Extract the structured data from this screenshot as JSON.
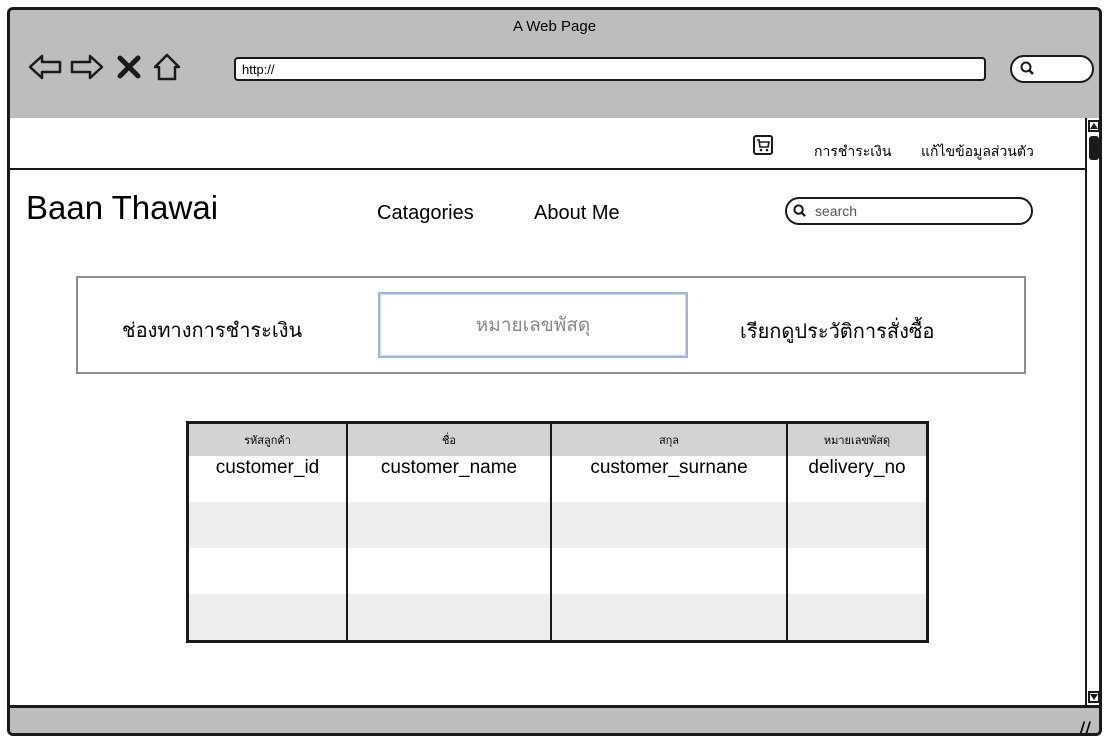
{
  "window": {
    "title": "A Web Page"
  },
  "browser": {
    "url": "http://",
    "nav": {
      "back_icon": "arrow-left-icon",
      "forward_icon": "arrow-right-icon",
      "stop_icon": "close-icon",
      "home_icon": "home-icon"
    }
  },
  "topbar": {
    "cart_icon": "cart-icon",
    "links": [
      "การชำระเงิน",
      "แก้ไขข้อมูลส่วนตัว"
    ]
  },
  "site": {
    "brand": "Baan Thawai",
    "nav": [
      "Catagories",
      "About Me"
    ],
    "search_placeholder": "search"
  },
  "panel": {
    "left_label": "ช่องทางการชำระเงิน",
    "input_placeholder": "หมายเลขพัสดุ",
    "right_label": "เรียกดูประวัติการสั่งซื้อ"
  },
  "table": {
    "headers": [
      "รหัสลูกค้า",
      "ชื่อ",
      "สกุล",
      "หมายเลขพัสดุ"
    ],
    "rows": [
      [
        "customer_id",
        "customer_name",
        "customer_surnane",
        "delivery_no"
      ],
      [
        "",
        "",
        "",
        ""
      ],
      [
        "",
        "",
        "",
        ""
      ],
      [
        "",
        "",
        "",
        ""
      ]
    ]
  },
  "colors": {
    "frame": "#1a1a1a",
    "chrome": "#bdbdbd",
    "header_bg": "#d3d3d3",
    "stripe": "#eeeeee",
    "focus_border": "#9fb6d8"
  }
}
